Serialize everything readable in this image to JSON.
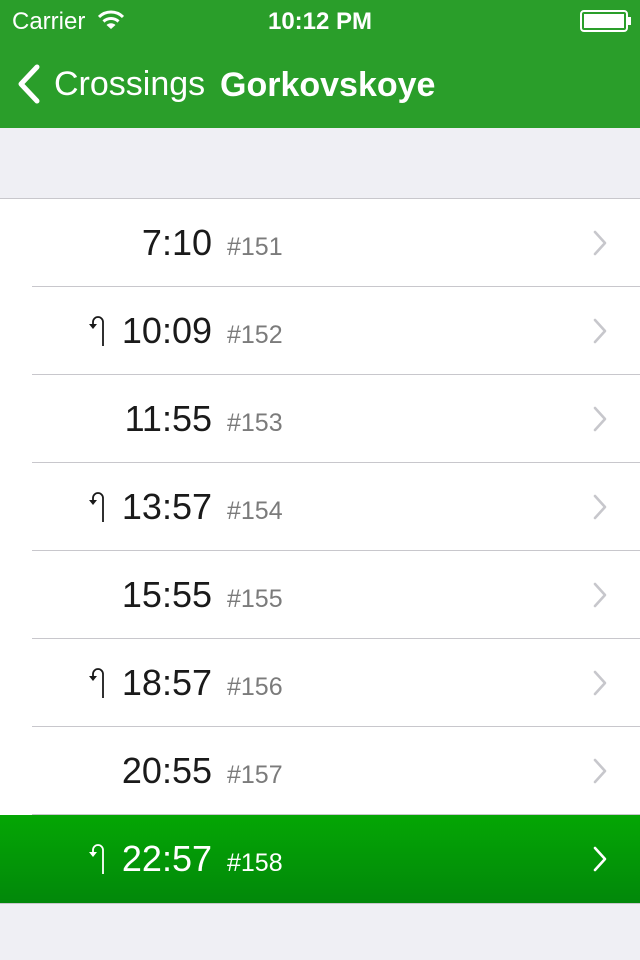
{
  "status_bar": {
    "carrier": "Carrier",
    "time": "10:12 PM"
  },
  "nav": {
    "back_label": "Crossings",
    "title": "Gorkovskoye"
  },
  "colors": {
    "accent": "#2a9e2a",
    "selected_row": "#02a002"
  },
  "crossings": [
    {
      "time": "7:10",
      "number": "#151",
      "return_icon": false,
      "selected": false
    },
    {
      "time": "10:09",
      "number": "#152",
      "return_icon": true,
      "selected": false
    },
    {
      "time": "11:55",
      "number": "#153",
      "return_icon": false,
      "selected": false
    },
    {
      "time": "13:57",
      "number": "#154",
      "return_icon": true,
      "selected": false
    },
    {
      "time": "15:55",
      "number": "#155",
      "return_icon": false,
      "selected": false
    },
    {
      "time": "18:57",
      "number": "#156",
      "return_icon": true,
      "selected": false
    },
    {
      "time": "20:55",
      "number": "#157",
      "return_icon": false,
      "selected": false
    },
    {
      "time": "22:57",
      "number": "#158",
      "return_icon": true,
      "selected": true
    }
  ]
}
